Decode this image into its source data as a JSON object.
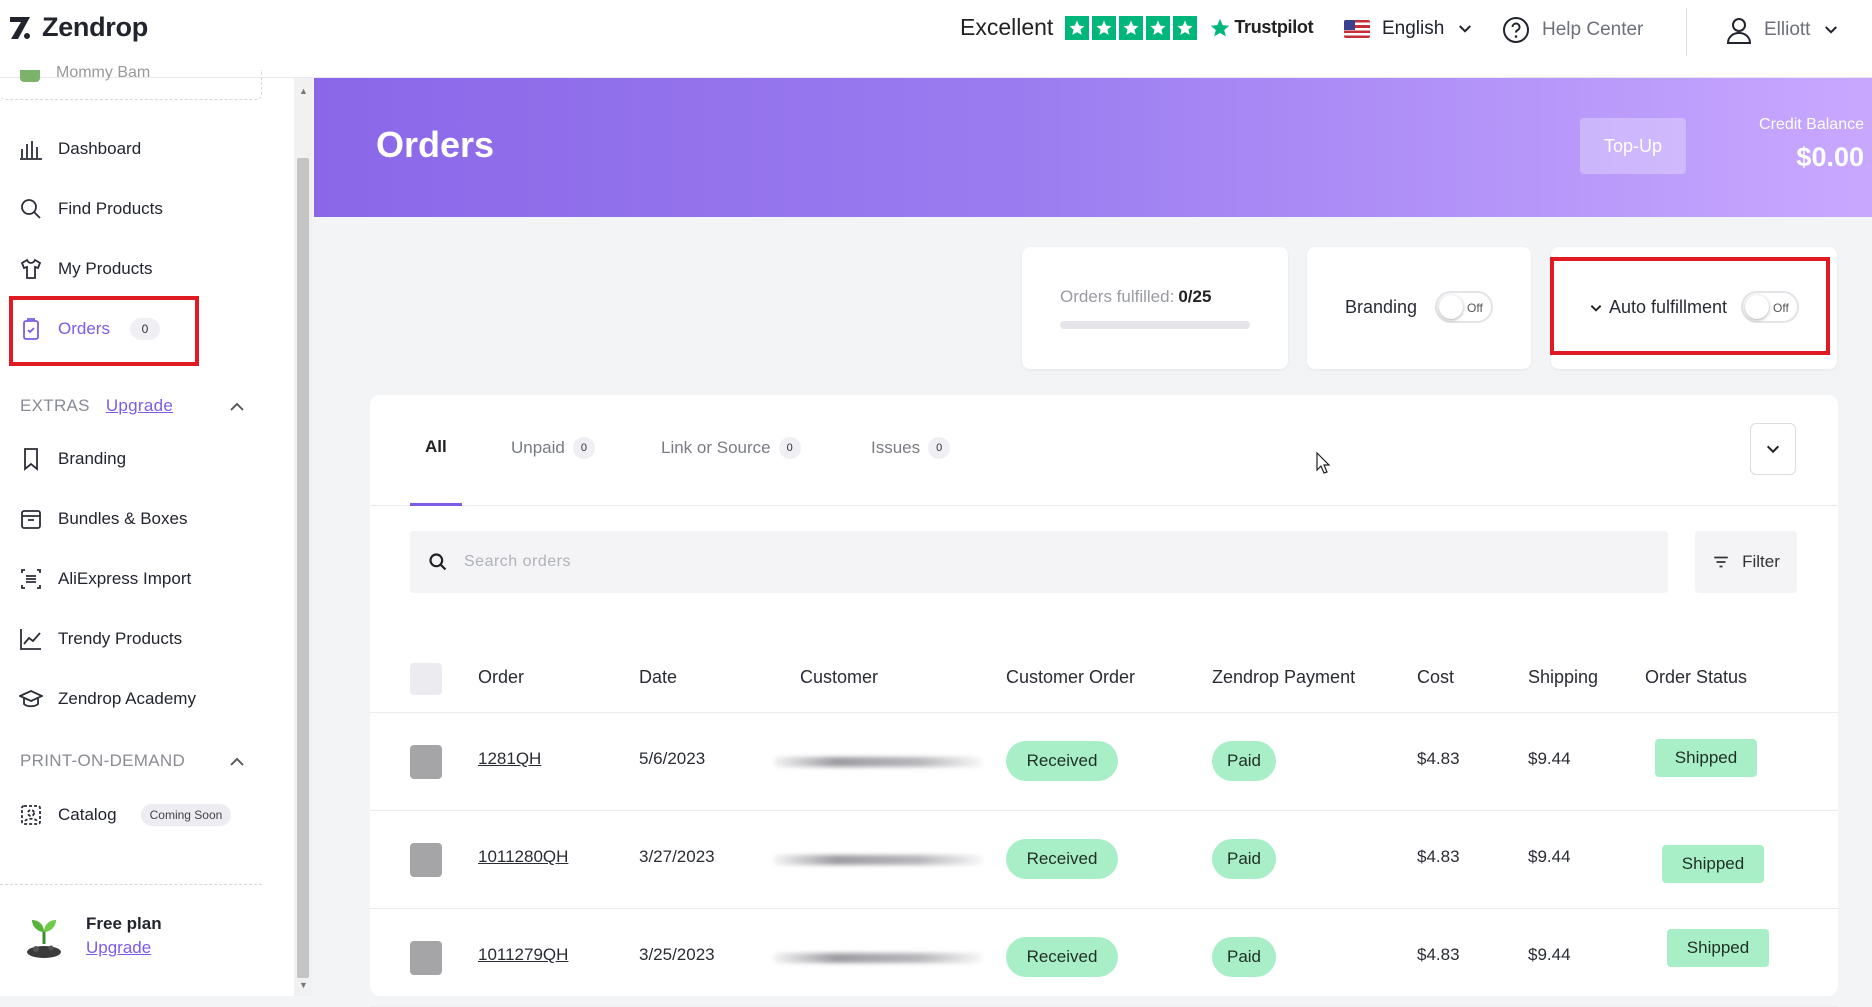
{
  "topbar": {
    "logo_text": "Zendrop",
    "rating_word": "Excellent",
    "rating_stars": 5,
    "trustpilot_label": "Trustpilot",
    "language": "English",
    "help_label": "Help Center",
    "user_name": "Elliott"
  },
  "sidebar": {
    "store_name": "Mommy Bam",
    "nav": [
      {
        "label": "Dashboard",
        "icon": "bar-chart-icon"
      },
      {
        "label": "Find Products",
        "icon": "search-icon"
      },
      {
        "label": "My Products",
        "icon": "shirt-icon"
      },
      {
        "label": "Orders",
        "icon": "clipboard-icon",
        "count": "0",
        "active": true
      }
    ],
    "extras_heading": "EXTRAS",
    "extras_upgrade": "Upgrade",
    "extras": [
      {
        "label": "Branding",
        "icon": "bookmark-icon"
      },
      {
        "label": "Bundles & Boxes",
        "icon": "box-icon"
      },
      {
        "label": "AliExpress Import",
        "icon": "import-icon"
      },
      {
        "label": "Trendy Products",
        "icon": "trend-icon"
      },
      {
        "label": "Zendrop Academy",
        "icon": "graduation-cap-icon"
      }
    ],
    "pod_heading": "PRINT-ON-DEMAND",
    "pod": [
      {
        "label": "Catalog",
        "icon": "catalog-icon",
        "badge": "Coming Soon"
      }
    ],
    "plan_title": "Free plan",
    "plan_upgrade": "Upgrade"
  },
  "banner": {
    "title": "Orders",
    "topup_label": "Top-Up",
    "credit_label": "Credit Balance",
    "credit_value": "$0.00"
  },
  "stats": {
    "fulfilled_label": "Orders fulfilled:",
    "fulfilled_value": "0/25",
    "fulfilled_fraction": 0,
    "branding_label": "Branding",
    "branding_toggle": "Off",
    "auto_label": "Auto fulfillment",
    "auto_toggle": "Off"
  },
  "tabs": [
    {
      "label": "All"
    },
    {
      "label": "Unpaid",
      "count": "0"
    },
    {
      "label": "Link or Source",
      "count": "0"
    },
    {
      "label": "Issues",
      "count": "0"
    }
  ],
  "search": {
    "placeholder": "Search orders"
  },
  "filter_label": "Filter",
  "table": {
    "columns": [
      "Order",
      "Date",
      "Customer",
      "Customer Order",
      "Zendrop Payment",
      "Cost",
      "Shipping",
      "Order Status"
    ],
    "rows": [
      {
        "order": "1281QH",
        "date": "5/6/2023",
        "customer_order": "Received",
        "payment": "Paid",
        "cost": "$4.83",
        "shipping": "$9.44",
        "status": "Shipped"
      },
      {
        "order": "1011280QH",
        "date": "3/27/2023",
        "customer_order": "Received",
        "payment": "Paid",
        "cost": "$4.83",
        "shipping": "$9.44",
        "status": "Shipped"
      },
      {
        "order": "1011279QH",
        "date": "3/25/2023",
        "customer_order": "Received",
        "payment": "Paid",
        "cost": "$4.83",
        "shipping": "$9.44",
        "status": "Shipped"
      }
    ]
  },
  "colors": {
    "accent": "#7c5ce6",
    "status_green": "#a8efc7",
    "highlight_red": "#e01a22",
    "trustpilot_green": "#00b67a"
  }
}
